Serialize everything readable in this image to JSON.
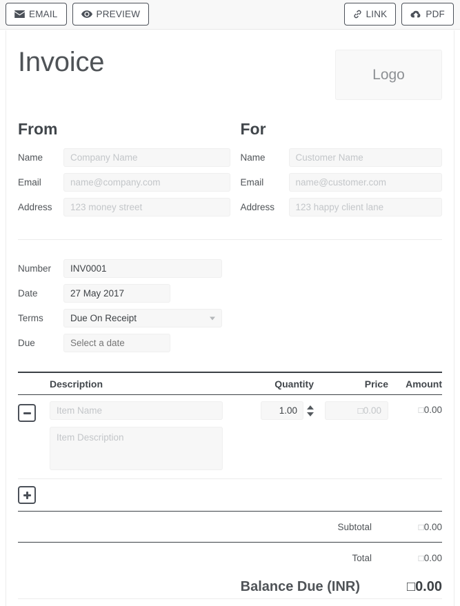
{
  "toolbar": {
    "left_buttons": [
      {
        "label": "EMAIL",
        "icon": "envelope-icon"
      },
      {
        "label": "PREVIEW",
        "icon": "eye-icon"
      }
    ],
    "right_buttons": [
      {
        "label": "LINK",
        "icon": "link-icon"
      },
      {
        "label": "PDF",
        "icon": "cloud-download-icon"
      }
    ]
  },
  "header": {
    "title": "Invoice",
    "logo_placeholder": "Logo"
  },
  "from": {
    "heading": "From",
    "fields": [
      {
        "label": "Name",
        "value": "",
        "placeholder": "Company Name"
      },
      {
        "label": "Email",
        "value": "",
        "placeholder": "name@company.com"
      },
      {
        "label": "Address",
        "value": "",
        "placeholder": "123 money street"
      }
    ]
  },
  "for": {
    "heading": "For",
    "fields": [
      {
        "label": "Name",
        "value": "",
        "placeholder": "Customer Name"
      },
      {
        "label": "Email",
        "value": "",
        "placeholder": "name@customer.com"
      },
      {
        "label": "Address",
        "value": "",
        "placeholder": "123 happy client lane"
      }
    ]
  },
  "meta": {
    "number": {
      "label": "Number",
      "value": "INV0001"
    },
    "date": {
      "label": "Date",
      "value": "27 May 2017"
    },
    "terms": {
      "label": "Terms",
      "value": "Due On Receipt"
    },
    "due": {
      "label": "Due",
      "value": "",
      "placeholder": "Select a date"
    }
  },
  "items_table": {
    "columns": {
      "description": "Description",
      "quantity": "Quantity",
      "price": "Price",
      "amount": "Amount"
    },
    "rows": [
      {
        "name_placeholder": "Item Name",
        "name_value": "",
        "description_placeholder": "Item Description",
        "description_value": "",
        "quantity": "1.00",
        "price_placeholder": "0.00",
        "price_value": "",
        "amount": "0.00",
        "remove_label": "–"
      }
    ],
    "add_label": "+"
  },
  "totals": {
    "subtotal": {
      "label": "Subtotal",
      "value": "0.00"
    },
    "total": {
      "label": "Total",
      "value": "0.00"
    },
    "balance_due": {
      "label": "Balance Due (INR)",
      "value": "0.00"
    }
  },
  "currency": {
    "code": "INR",
    "symbol_glyph": "□"
  },
  "colors": {
    "toolbar_bg": "#f8f8f8",
    "button_border": "#4b5058",
    "text": "#4f5357",
    "input_bg": "#f7f7f7",
    "placeholder": "#c3c6c9",
    "rule_dark": "#3a3f44",
    "rule_light": "#ececec"
  }
}
